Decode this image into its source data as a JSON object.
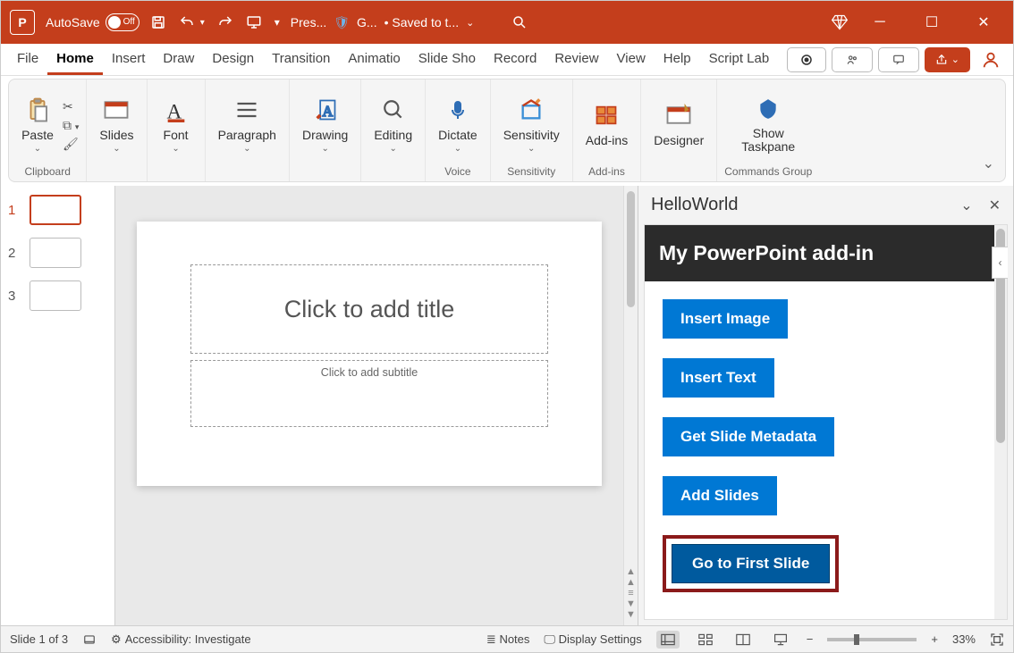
{
  "titlebar": {
    "autosave_label": "AutoSave",
    "autosave_state": "Off",
    "doc_name": "Pres...",
    "confidentiality": "G...",
    "save_state": "• Saved to t...",
    "search_icon": "search"
  },
  "tabs": [
    "File",
    "Home",
    "Insert",
    "Draw",
    "Design",
    "Transition",
    "Animatio",
    "Slide Sho",
    "Record",
    "Review",
    "View",
    "Help",
    "Script Lab"
  ],
  "active_tab": "Home",
  "ribbon": {
    "groups": [
      {
        "label": "Clipboard",
        "items": [
          {
            "label": "Paste"
          }
        ]
      },
      {
        "label": "",
        "items": [
          {
            "label": "Slides"
          }
        ]
      },
      {
        "label": "",
        "items": [
          {
            "label": "Font"
          }
        ]
      },
      {
        "label": "",
        "items": [
          {
            "label": "Paragraph"
          }
        ]
      },
      {
        "label": "",
        "items": [
          {
            "label": "Drawing"
          }
        ]
      },
      {
        "label": "",
        "items": [
          {
            "label": "Editing"
          }
        ]
      },
      {
        "label": "Voice",
        "items": [
          {
            "label": "Dictate"
          }
        ]
      },
      {
        "label": "Sensitivity",
        "items": [
          {
            "label": "Sensitivity"
          }
        ]
      },
      {
        "label": "Add-ins",
        "items": [
          {
            "label": "Add-ins"
          }
        ]
      },
      {
        "label": "",
        "items": [
          {
            "label": "Designer"
          }
        ]
      },
      {
        "label": "Commands Group",
        "items": [
          {
            "label": "Show Taskpane"
          }
        ]
      }
    ]
  },
  "thumbs": [
    {
      "num": "1"
    },
    {
      "num": "2"
    },
    {
      "num": "3"
    }
  ],
  "slide": {
    "title_placeholder": "Click to add title",
    "subtitle_placeholder": "Click to add subtitle"
  },
  "taskpane": {
    "title": "HelloWorld",
    "banner": "My PowerPoint add-in",
    "buttons": [
      "Insert Image",
      "Insert Text",
      "Get Slide Metadata",
      "Add Slides",
      "Go to First Slide"
    ],
    "highlighted_index": 4
  },
  "statusbar": {
    "slide_info": "Slide 1 of 3",
    "accessibility": "Accessibility: Investigate",
    "notes": "Notes",
    "display": "Display Settings",
    "zoom": "33%"
  }
}
